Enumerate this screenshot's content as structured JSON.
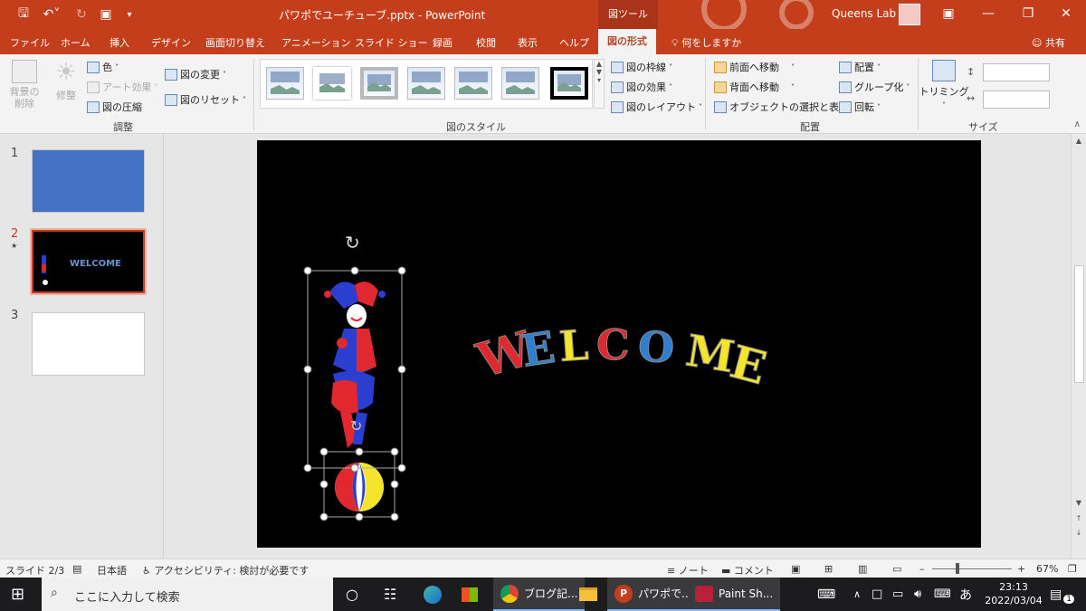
{
  "titlebar": {
    "quick_access": [
      "save-icon",
      "undo-icon",
      "redo-icon",
      "present-icon",
      "customize-icon"
    ],
    "file_title": "パワポでユーチューブ.pptx - PowerPoint",
    "context_label": "図ツール",
    "user_name": "Queens Lab",
    "window_buttons": [
      "ribbon-display-icon",
      "minimize-icon",
      "restore-icon",
      "close-icon"
    ]
  },
  "tabs": {
    "file": "ファイル",
    "home": "ホーム",
    "insert": "挿入",
    "design": "デザイン",
    "transitions": "画面切り替え",
    "animations": "アニメーション",
    "slideshow": "スライド ショー",
    "record": "録画",
    "review": "校閲",
    "view": "表示",
    "help": "ヘルプ",
    "picture_format": "図の形式",
    "tell_me": "何をしますか",
    "share": "共有"
  },
  "ribbon": {
    "adjust": {
      "remove_bg": "背景の削除",
      "corrections": "修整",
      "color": "色",
      "artistic": "アート効果",
      "compress": "図の圧縮",
      "change": "図の変更",
      "reset": "図のリセット",
      "group_label": "調整"
    },
    "styles": {
      "border": "図の枠線",
      "effects": "図の効果",
      "layout": "図のレイアウト",
      "group_label": "図のスタイル"
    },
    "arrange": {
      "forward": "前面へ移動",
      "backward": "背面へ移動",
      "selection": "オブジェクトの選択と表示",
      "align": "配置",
      "group": "グループ化",
      "rotate": "回転",
      "group_label": "配置"
    },
    "size": {
      "crop": "トリミング",
      "height_value": "",
      "width_value": "",
      "group_label": "サイズ"
    }
  },
  "slides": {
    "items": [
      {
        "number": "1",
        "color": "#4472c4"
      },
      {
        "number": "2",
        "color": "#000000"
      },
      {
        "number": "3",
        "color": "#ffffff"
      }
    ],
    "thumb_welcome": "WELCOME"
  },
  "slide_content": {
    "welcome_letters": [
      {
        "ch": "W",
        "color": "#e0282e"
      },
      {
        "ch": "E",
        "color": "#2f7fd1"
      },
      {
        "ch": "L",
        "color": "#f4e52c"
      },
      {
        "ch": "C",
        "color": "#e0282e"
      },
      {
        "ch": "O",
        "color": "#2f7fd1"
      },
      {
        "ch": "M",
        "color": "#f4e52c"
      },
      {
        "ch": "E",
        "color": "#f4e52c"
      }
    ]
  },
  "status": {
    "slide_counter": "スライド 2/3",
    "language": "日本語",
    "accessibility": "アクセシビリティ: 検討が必要です",
    "notes": "ノート",
    "comments": "コメント",
    "zoom": "67%"
  },
  "taskbar": {
    "search_placeholder": "ここに入力して検索",
    "chrome_label": "ブログ記...",
    "ppt_label": "パワポで...",
    "paint_label": "Paint Sh...",
    "ime": "あ",
    "time": "23:13",
    "date": "2022/03/04",
    "notification_count": "1"
  },
  "colors": {
    "accent": "#c43e1c",
    "taskbar": "#1c1c1e"
  }
}
